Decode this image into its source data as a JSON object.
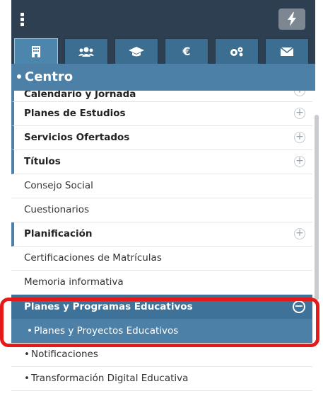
{
  "topbar": {
    "menu_icon": "kebab-menu-icon",
    "action_icon": "bolt-icon"
  },
  "tabs": [
    {
      "icon": "building-icon",
      "active": true
    },
    {
      "icon": "users-icon",
      "active": false
    },
    {
      "icon": "graduation-cap-icon",
      "active": false
    },
    {
      "icon": "euro-icon",
      "active": false
    },
    {
      "icon": "gears-icon",
      "active": false
    },
    {
      "icon": "envelope-icon",
      "active": false
    }
  ],
  "section": {
    "title": "Centro"
  },
  "menu": {
    "items": [
      {
        "label": "Calendario y Jornada",
        "type": "expandable",
        "state": "collapsed"
      },
      {
        "label": "Planes de Estudios",
        "type": "expandable",
        "state": "collapsed"
      },
      {
        "label": "Servicios Ofertados",
        "type": "expandable",
        "state": "collapsed"
      },
      {
        "label": "Títulos",
        "type": "expandable",
        "state": "collapsed"
      },
      {
        "label": "Consejo Social",
        "type": "link"
      },
      {
        "label": "Cuestionarios",
        "type": "link"
      },
      {
        "label": "Planificación",
        "type": "expandable",
        "state": "collapsed"
      },
      {
        "label": "Certificaciones de Matrículas",
        "type": "link"
      },
      {
        "label": "Memoria informativa",
        "type": "link"
      }
    ],
    "group": {
      "label": "Planes y Programas Educativos",
      "state": "expanded",
      "children": [
        {
          "label": "Planes y Proyectos Educativos",
          "selected": true
        },
        {
          "label": "Notificaciones",
          "selected": false
        },
        {
          "label": "Transformación Digital Educativa",
          "selected": false
        }
      ]
    }
  },
  "colors": {
    "header_dark": "#2d3f50",
    "accent_blue": "#4c80a7",
    "highlight_red": "#e41a1a"
  }
}
